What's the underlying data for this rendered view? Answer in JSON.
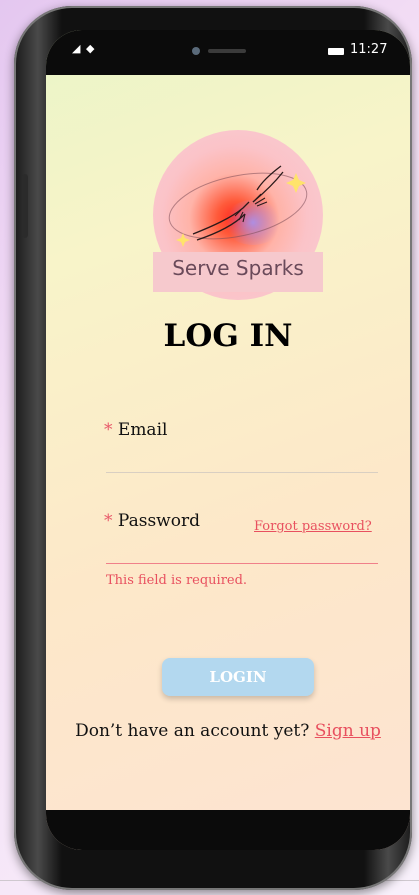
{
  "status_bar": {
    "left_icons": "◢ ◆",
    "time": "11:27"
  },
  "logo": {
    "text": "Serve Sparks"
  },
  "title": "LOG IN",
  "form": {
    "required_mark": "*",
    "email_label": "Email",
    "password_label": "Password",
    "forgot_password": "Forgot password?",
    "error_message": "This field is required."
  },
  "login_button": "LOGIN",
  "signup": {
    "prompt": "Don’t have an account yet?",
    "link": "Sign up"
  },
  "colors": {
    "accent_red": "#e8505f",
    "button_bg": "#b3d8ef"
  }
}
